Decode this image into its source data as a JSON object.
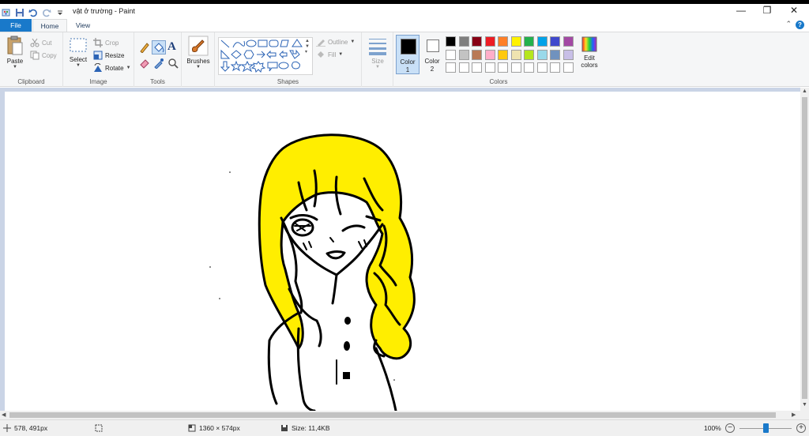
{
  "window": {
    "title": "vật ở trường - Paint",
    "minimize_glyph": "—",
    "restore_glyph": "❐",
    "close_glyph": "✕"
  },
  "tabs": {
    "file": "File",
    "home": "Home",
    "view": "View",
    "collapse_glyph": "⌃",
    "help_glyph": "?"
  },
  "ribbon": {
    "clipboard": {
      "label": "Clipboard",
      "paste": "Paste",
      "cut": "Cut",
      "copy": "Copy"
    },
    "image": {
      "label": "Image",
      "select": "Select",
      "crop": "Crop",
      "resize": "Resize",
      "rotate": "Rotate"
    },
    "tools": {
      "label": "Tools"
    },
    "brushes": {
      "label": "Brushes"
    },
    "shapes": {
      "label": "Shapes",
      "outline": "Outline",
      "fill": "Fill"
    },
    "size": {
      "label": "Size"
    },
    "colors": {
      "label": "Colors",
      "color1_label": "Color",
      "color1_num": "1",
      "color2_label": "Color",
      "color2_num": "2",
      "edit_line1": "Edit",
      "edit_line2": "colors",
      "color1": "#000000",
      "color2": "#ffffff",
      "palette_row1": [
        "#000000",
        "#7f7f7f",
        "#880015",
        "#ed1c24",
        "#ff7f27",
        "#fff200",
        "#22b14c",
        "#00a2e8",
        "#3f48cc",
        "#a349a4"
      ],
      "palette_row2": [
        "#ffffff",
        "#c3c3c3",
        "#b97a57",
        "#ffaec9",
        "#ffc90e",
        "#efe4b0",
        "#b5e61d",
        "#99d9ea",
        "#7092be",
        "#c8bfe7"
      ],
      "palette_row3": [
        "#ffffff",
        "#ffffff",
        "#ffffff",
        "#ffffff",
        "#ffffff",
        "#ffffff",
        "#ffffff",
        "#ffffff",
        "#ffffff",
        "#ffffff"
      ]
    }
  },
  "status": {
    "cursor_pos": "578, 491px",
    "dimensions": "1360 × 574px",
    "size": "Size: 11,4KB",
    "zoom": "100%",
    "zoom_level": 0.5
  },
  "drawing": {
    "hair_color": "#ffee00",
    "line_color": "#000000"
  }
}
